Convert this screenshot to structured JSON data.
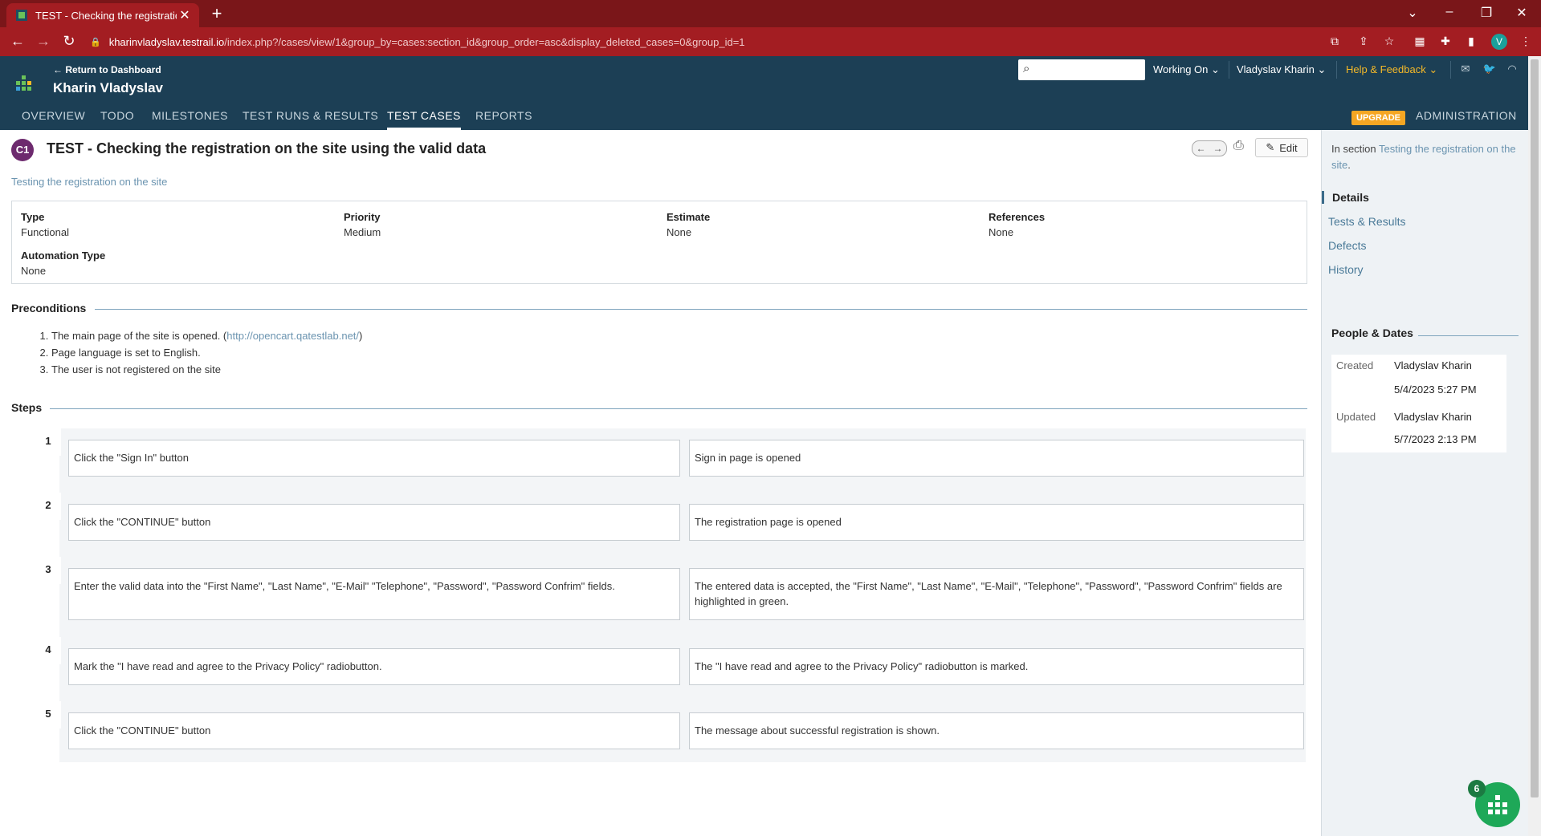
{
  "browser": {
    "tab_title": "TEST - Checking the registration",
    "url_host": "kharinvladyslav.testrail.io",
    "url_path": "/index.php?/cases/view/1&group_by=cases:section_id&group_order=asc&display_deleted_cases=0&group_id=1",
    "profile_initial": "V"
  },
  "header": {
    "return_link": "← Return to Dashboard",
    "project_name": "Kharin Vladyslav",
    "working_on": "Working On",
    "user_menu": "Vladyslav Kharin",
    "help": "Help & Feedback",
    "upgrade": "UPGRADE",
    "admin": "ADMINISTRATION",
    "tabs": [
      "OVERVIEW",
      "TODO",
      "MILESTONES",
      "TEST RUNS & RESULTS",
      "TEST CASES",
      "REPORTS"
    ]
  },
  "case": {
    "id_badge": "C1",
    "title": "TEST - Checking the registration on the site using the valid data",
    "edit_label": "Edit",
    "section_link": "Testing the registration on the site",
    "props": {
      "type_label": "Type",
      "type_value": "Functional",
      "priority_label": "Priority",
      "priority_value": "Medium",
      "estimate_label": "Estimate",
      "estimate_value": "None",
      "references_label": "References",
      "references_value": "None",
      "automation_label": "Automation Type",
      "automation_value": "None"
    },
    "preconditions_title": "Preconditions",
    "preconditions": {
      "p1_text": "The main page of the site is opened. (",
      "p1_link": "http://opencart.qatestlab.net/",
      "p1_close": ")",
      "p2": "Page language is set to English.",
      "p3": "The user is not registered on the site"
    },
    "steps_title": "Steps",
    "steps": [
      {
        "num": "1",
        "action": "Click the \"Sign In\" button",
        "expected": "Sign in page is opened"
      },
      {
        "num": "2",
        "action": "Click the \"CONTINUE\" button",
        "expected": "The registration page is opened"
      },
      {
        "num": "3",
        "action": "Enter the valid data into the \"First Name\", \"Last Name\", \"E-Mail\" \"Telephone\", \"Password\", \"Password Confrim\" fields.",
        "expected": "The entered data is accepted, the \"First Name\", \"Last Name\", \"E-Mail\", \"Telephone\", \"Password\", \"Password Confrim\" fields are highlighted in green."
      },
      {
        "num": "4",
        "action": "Mark the \"I have read and agree to the Privacy Policy\" radiobutton.",
        "expected": "The \"I have read and agree to the Privacy Policy\" radiobutton is marked."
      },
      {
        "num": "5",
        "action": "Click the \"CONTINUE\" button",
        "expected": "The message about successful registration is shown."
      }
    ]
  },
  "sidebar": {
    "in_section_prefix": "In section ",
    "in_section_link": "Testing the registration on the site",
    "in_section_suffix": ".",
    "tabs": [
      "Details",
      "Tests & Results",
      "Defects",
      "History"
    ],
    "people_title": "People & Dates",
    "created_label": "Created",
    "created_by": "Vladyslav Kharin",
    "created_date": "5/4/2023 5:27 PM",
    "updated_label": "Updated",
    "updated_by": "Vladyslav Kharin",
    "updated_date": "5/7/2023 2:13 PM"
  },
  "fab_badge": "6",
  "colors": {
    "header": "#1c3f55",
    "browser": "#a31d22",
    "accent_link": "#6b94b0",
    "upgrade": "#f5a623",
    "fab": "#1ea858"
  }
}
